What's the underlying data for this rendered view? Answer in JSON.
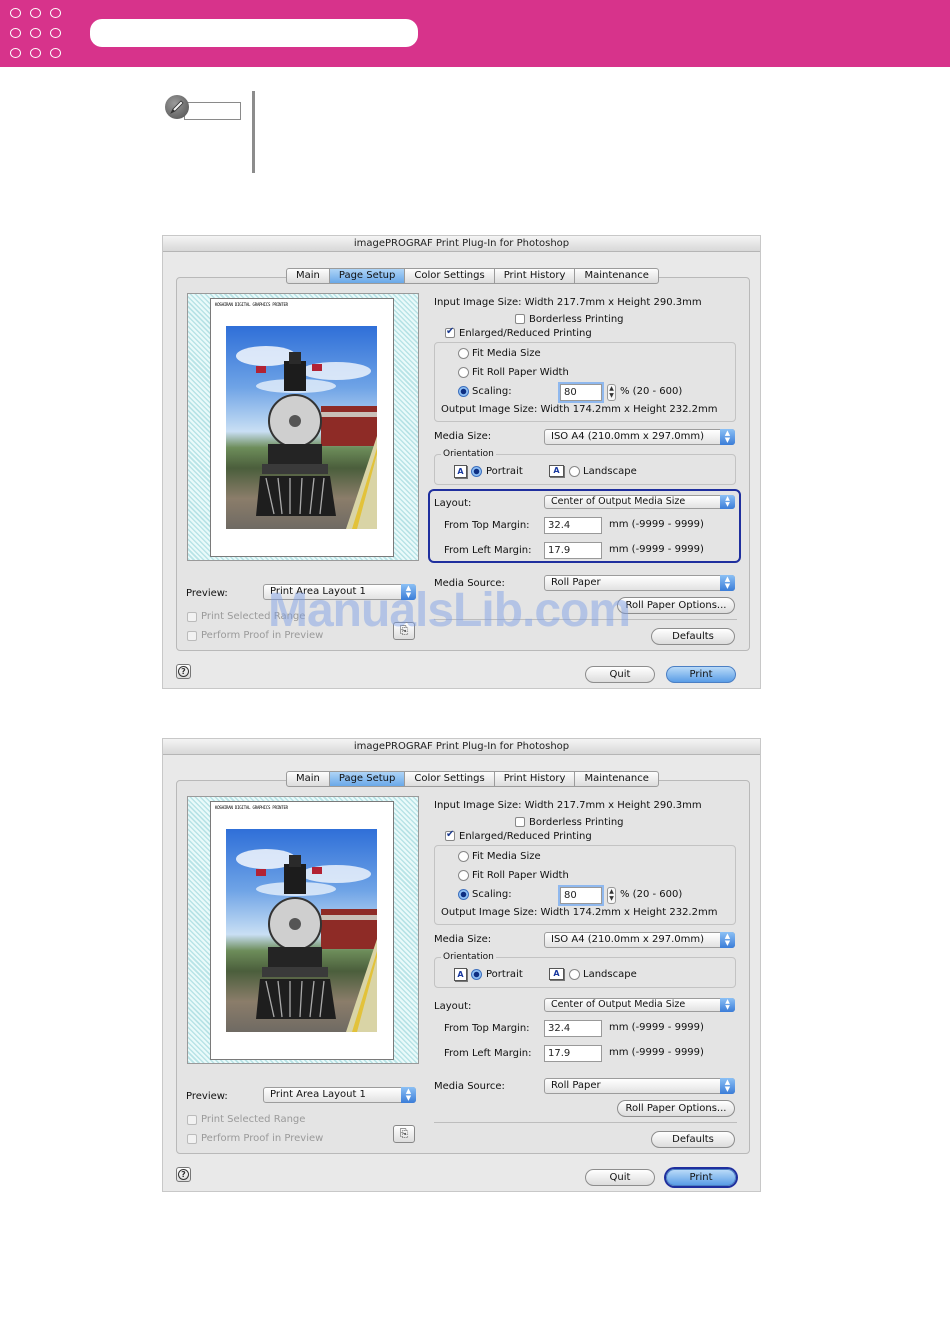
{
  "dialogs": [
    {
      "title": "imagePROGRAF Print Plug-In for Photoshop",
      "tabs": [
        "Main",
        "Page Setup",
        "Color Settings",
        "Print History",
        "Maintenance"
      ],
      "selected_tab": "Page Setup",
      "preview_caption": "KOSHIRAN DIGITAL GRAPHICS PRINTER",
      "input_image_size": "Input Image Size: Width 217.7mm x Height 290.3mm",
      "borderless_label": "Borderless Printing",
      "enlarged_label": "Enlarged/Reduced Printing",
      "fit_media_label": "Fit Media Size",
      "fit_roll_label": "Fit Roll Paper Width",
      "scaling_label": "Scaling:",
      "scaling_value": "80",
      "scaling_range": "%  (20 - 600)",
      "output_image_size": "Output Image Size: Width 174.2mm x Height 232.2mm",
      "media_size_label": "Media Size:",
      "media_size_value": "ISO A4 (210.0mm x 297.0mm)",
      "orientation_label": "Orientation",
      "portrait_label": "Portrait",
      "landscape_label": "Landscape",
      "layout_label": "Layout:",
      "layout_value": "Center of Output Media Size",
      "top_margin_label": "From Top Margin:",
      "top_margin_value": "32.4",
      "top_margin_range": "mm (-9999 - 9999)",
      "left_margin_label": "From Left Margin:",
      "left_margin_value": "17.9",
      "left_margin_range": "mm (-9999 - 9999)",
      "preview_label": "Preview:",
      "preview_value": "Print Area Layout 1",
      "print_selected_label": "Print Selected Range",
      "perform_proof_label": "Perform Proof in Preview",
      "media_source_label": "Media Source:",
      "media_source_value": "Roll Paper",
      "roll_paper_options_label": "Roll Paper Options...",
      "defaults_label": "Defaults",
      "quit_label": "Quit",
      "print_label": "Print",
      "help_label": "?"
    }
  ],
  "watermark": "ManualsLib.com",
  "colors": {
    "header_bg": "#d7338b",
    "highlight_outline": "#1f2f9e",
    "selected_tab": "#6aa8e8"
  }
}
